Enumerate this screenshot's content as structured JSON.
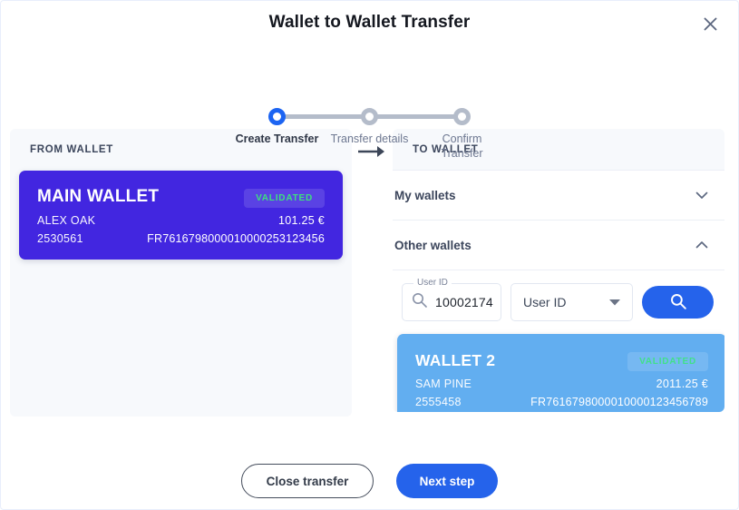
{
  "header": {
    "title": "Wallet to Wallet Transfer",
    "close_icon": "close-icon"
  },
  "stepper": {
    "steps": [
      {
        "label": "Create Transfer",
        "state": "active"
      },
      {
        "label": "Transfer details",
        "state": "inactive"
      },
      {
        "label": "Confirm\nTransfer",
        "state": "inactive"
      }
    ],
    "active_color": "#1c64f2",
    "inactive_color": "#b4bcca"
  },
  "transfer_arrow_icon": "arrow-right-icon",
  "from_panel": {
    "header": "FROM WALLET",
    "wallet": {
      "name": "MAIN WALLET",
      "badge": "VALIDATED",
      "owner": "ALEX OAK",
      "id": "2530561",
      "amount": "101.25 €",
      "iban": "FR7616798000010000253123456",
      "color": "#4226e0",
      "badge_color": "#3de07e"
    }
  },
  "to_panel": {
    "header": "TO WALLET",
    "accordions": [
      {
        "title": "My wallets",
        "expanded": false,
        "icon": "chevron-down-icon"
      },
      {
        "title": "Other wallets",
        "expanded": true,
        "icon": "chevron-up-icon"
      }
    ],
    "search": {
      "field_label": "User ID",
      "field_value": "10002174",
      "field_icon": "search-icon",
      "select_value": "User ID",
      "select_icon": "caret-down-icon",
      "button_icon": "search-icon",
      "button_color": "#2563eb"
    },
    "wallet": {
      "name": "WALLET 2",
      "badge": "VALIDATED",
      "owner": "SAM PINE",
      "id": "2555458",
      "amount": "2011.25 €",
      "iban": "FR7616798000010000123456789",
      "color": "#62aef0",
      "badge_color": "#41e08a"
    }
  },
  "footer": {
    "close_label": "Close transfer",
    "next_label": "Next step"
  }
}
